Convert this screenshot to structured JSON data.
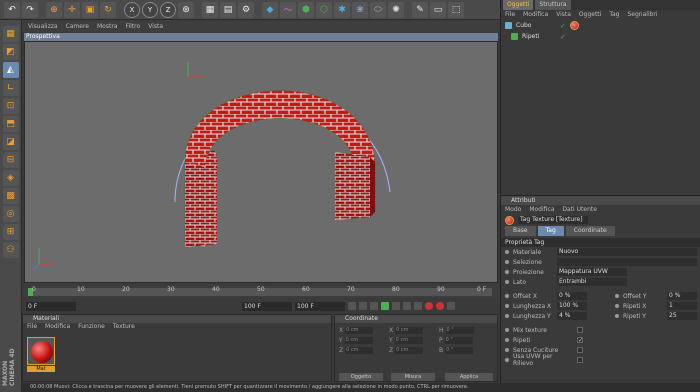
{
  "toolbar": {
    "buttons": [
      "undo-icon",
      "redo-icon",
      "move-icon",
      "scale-icon",
      "rotate-icon",
      "x-axis",
      "y-axis",
      "z-axis",
      "world-icon",
      "render-icon",
      "render-settings-icon",
      "cube-icon",
      "spline-icon",
      "nurbs-icon",
      "array-icon",
      "deformer-icon",
      "scene-icon",
      "light-icon",
      "camera-icon"
    ],
    "axis_x": "X",
    "axis_y": "Y",
    "axis_z": "Z"
  },
  "viewport": {
    "menu": [
      "Visualizza",
      "Camere",
      "Mostra",
      "Filtro",
      "Vista"
    ],
    "title": "Prospettiva"
  },
  "timeline": {
    "ticks": [
      "0",
      "10",
      "20",
      "30",
      "40",
      "50",
      "60",
      "70",
      "80",
      "90"
    ],
    "end_label": "0 F",
    "start_field": "0 F",
    "current_field": "100 F",
    "end_field": "100 F"
  },
  "materials": {
    "title": "Materiali",
    "menu": [
      "File",
      "Modifica",
      "Funzione",
      "Texture"
    ],
    "item_label": "Mat"
  },
  "coordinates": {
    "title": "Coordinate",
    "rows": [
      [
        "X",
        "0 cm",
        "X",
        "0 cm",
        "H",
        "0 °"
      ],
      [
        "Y",
        "0 cm",
        "Y",
        "0 cm",
        "P",
        "0 °"
      ],
      [
        "Z",
        "0 cm",
        "Z",
        "0 cm",
        "B",
        "0 °"
      ]
    ],
    "mode1": "Oggetto",
    "mode2": "Misura",
    "apply": "Applica"
  },
  "status": {
    "text": "00:00:08   Muovi: Clicca e trascina per muovere gli elementi. Tieni premuto SHIFT per quantizzare il movimento / aggiungere alla selezione in modo punto, CTRL per rimuovere."
  },
  "objects": {
    "tabs": [
      "Oggetti",
      "Struttura"
    ],
    "menu": [
      "File",
      "Modifica",
      "Vista",
      "Oggetti",
      "Tag",
      "Segnalibri"
    ],
    "rows": [
      {
        "name": "Cubo"
      },
      {
        "name": "Ripeti"
      }
    ]
  },
  "attributes": {
    "header": "Attributi",
    "menu": [
      "Modo",
      "Modifica",
      "Dati Utente"
    ],
    "object_name": "Tag Texture [Texture]",
    "tabs": [
      "Base",
      "Tag",
      "Coordinate"
    ],
    "section": "Proprietà Tag",
    "props": [
      {
        "label": "Materiale",
        "value": "Nuovo"
      },
      {
        "label": "Selezione",
        "value": ""
      },
      {
        "label": "Proiezione",
        "value": "Mappatura UVW"
      },
      {
        "label": "Lato",
        "value": "Entrambi"
      }
    ],
    "pairs": [
      {
        "l1": "Offset X",
        "v1": "0 %",
        "l2": "Offset Y",
        "v2": "0 %"
      },
      {
        "l1": "Lunghezza X",
        "v1": "100 %",
        "l2": "Ripeti X",
        "v2": "1"
      },
      {
        "l1": "Lunghezza Y",
        "v1": "4 %",
        "l2": "Ripeti Y",
        "v2": "25"
      }
    ],
    "checks": [
      {
        "label": "Mix texture",
        "checked": false
      },
      {
        "label": "Ripeti",
        "checked": true
      },
      {
        "label": "Senza Cuciture",
        "checked": false
      },
      {
        "label": "Usa UVW per Rilievo",
        "checked": false
      }
    ]
  },
  "branding": {
    "vertical_text": "MAXON CINEMA 4D"
  },
  "colors": {
    "brick": "#c21a1a",
    "mortar": "#e6e6e6",
    "viewport_bg": "#6c6c6c",
    "accent": "#f0a020"
  }
}
